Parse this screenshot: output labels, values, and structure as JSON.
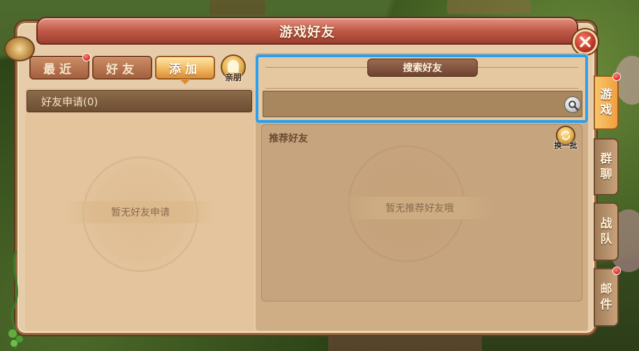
{
  "window": {
    "title": "游戏好友",
    "close_icon": "close-icon"
  },
  "tabs": [
    {
      "label": "最近",
      "active": false,
      "has_badge": true
    },
    {
      "label": "好友",
      "active": false,
      "has_badge": false
    },
    {
      "label": "添加",
      "active": true,
      "has_badge": false
    }
  ],
  "relatives_button": {
    "label": "亲朋",
    "icon": "person-icon"
  },
  "friend_requests": {
    "header": "好友申请(0)",
    "empty_text": "暂无好友申请"
  },
  "search": {
    "title": "搜索好友",
    "input_value": "",
    "placeholder": "",
    "icon": "search-icon"
  },
  "recommend": {
    "title": "推荐好友",
    "empty_text": "暂无推荐好友哦",
    "refresh_label": "换一批",
    "refresh_icon": "refresh-icon"
  },
  "side_tabs": [
    {
      "label": [
        "游",
        "戏"
      ],
      "active": true,
      "has_badge": true
    },
    {
      "label": [
        "群",
        "聊"
      ],
      "active": false,
      "has_badge": false
    },
    {
      "label": [
        "战",
        "队"
      ],
      "active": false,
      "has_badge": false
    },
    {
      "label": [
        "邮",
        "件"
      ],
      "active": false,
      "has_badge": true
    }
  ],
  "colors": {
    "highlight_border": "#2aa0f0",
    "title_bar": "#c05a48",
    "active_tab": "#f3b860",
    "badge": "#e0302a"
  }
}
